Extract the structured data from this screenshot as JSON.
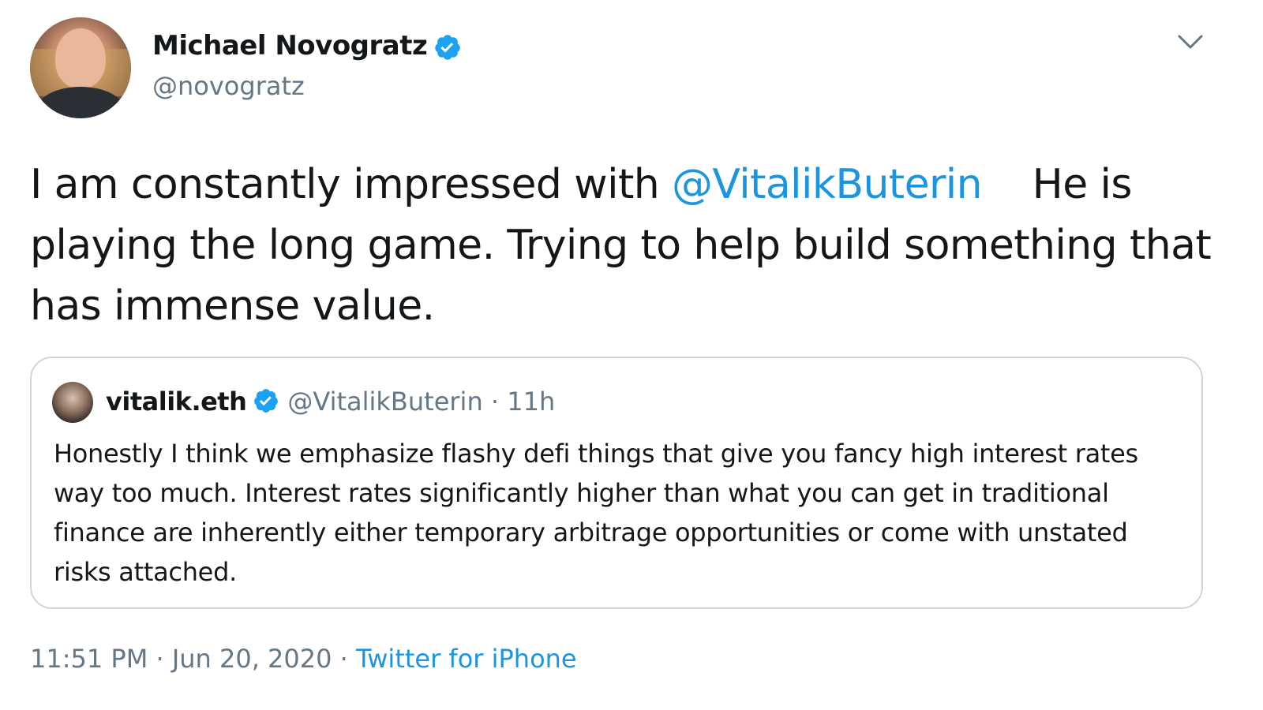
{
  "author": {
    "name": "Michael Novogratz",
    "handle": "@novogratz",
    "verified": true
  },
  "tweet": {
    "text_before": "I am constantly impressed with ",
    "mention": "@VitalikButerin",
    "text_after": "    He is playing the long game. Trying to help build something that has immense value."
  },
  "quoted_tweet": {
    "name": "vitalik.eth",
    "handle": "@VitalikButerin",
    "separator": "·",
    "time": "11h",
    "text": "Honestly I think we emphasize flashy defi things that give you fancy high interest rates way too much. Interest rates significantly higher than what you can get in traditional finance are inherently either temporary arbitrage opportunities or come with unstated risks attached."
  },
  "meta": {
    "time": "11:51 PM",
    "separator": "·",
    "date": "Jun 20, 2020",
    "separator2": "·",
    "source": "Twitter for iPhone"
  },
  "icons": {
    "verified": "verified-badge-icon",
    "menu": "chevron-down-icon"
  },
  "colors": {
    "link": "#1b95e0",
    "secondary": "#657786",
    "border": "#ccd6dd",
    "verified": "#1da1f2"
  }
}
